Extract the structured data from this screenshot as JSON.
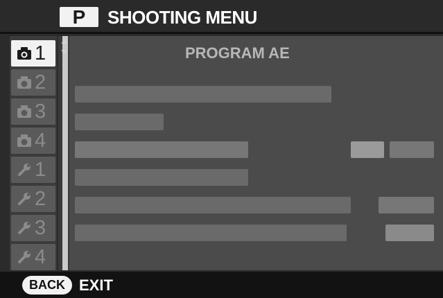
{
  "header": {
    "mode_badge": "P",
    "title": "SHOOTING MENU"
  },
  "tabs": [
    {
      "icon": "camera-icon",
      "label": "1",
      "active": true
    },
    {
      "icon": "camera-icon",
      "label": "2",
      "active": false
    },
    {
      "icon": "camera-icon",
      "label": "3",
      "active": false
    },
    {
      "icon": "camera-icon",
      "label": "4",
      "active": false
    },
    {
      "icon": "wrench-icon",
      "label": "1",
      "active": false
    },
    {
      "icon": "wrench-icon",
      "label": "2",
      "active": false
    },
    {
      "icon": "wrench-icon",
      "label": "3",
      "active": false
    },
    {
      "icon": "wrench-icon",
      "label": "4",
      "active": false
    }
  ],
  "panel": {
    "title": "PROGRAM AE"
  },
  "footer": {
    "back_label": "BACK",
    "exit_label": "EXIT"
  },
  "colors": {
    "background": "#2b2b2b",
    "panel": "#4b4b4b",
    "highlight": "#f1f1f1"
  }
}
